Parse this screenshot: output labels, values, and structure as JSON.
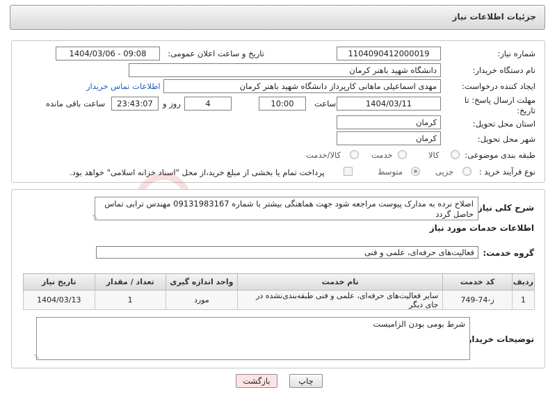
{
  "header": {
    "title": "جزئیات اطلاعات نیاز"
  },
  "form": {
    "need_number": {
      "label": "شماره نیاز:",
      "value": "1104090412000019"
    },
    "announce_datetime": {
      "label": "تاریخ و ساعت اعلان عمومی:",
      "value": "1404/03/06 - 09:08"
    },
    "buyer_org": {
      "label": "نام دستگاه خریدار:",
      "value": "دانشگاه شهید باهنر کرمان"
    },
    "requester": {
      "label": "ایجاد کننده درخواست:",
      "value": "مهدی اسماعیلی ماهانی  کارپرداز دانشگاه شهید باهنر کرمان",
      "link": "اطلاعات تماس خریدار"
    },
    "deadline": {
      "label_line1": "مهلت ارسال پاسخ: تا",
      "label_line2": "تاریخ:",
      "date": "1404/03/11",
      "time_label": "ساعت",
      "time": "10:00",
      "days": "4",
      "days_label": "روز و",
      "remaining": "23:43:07",
      "remaining_label": "ساعت باقی مانده"
    },
    "province": {
      "label": "استان محل تحویل:",
      "value": "کرمان"
    },
    "city": {
      "label": "شهر محل تحویل:",
      "value": "کرمان"
    },
    "category": {
      "label": "طبقه بندی موضوعی:",
      "options": [
        "کالا",
        "خدمت",
        "کالا/خدمت"
      ]
    },
    "purchase_type": {
      "label": "نوع فرآیند خرید :",
      "options": [
        "جزیی",
        "متوسط"
      ],
      "checkbox_text": "پرداخت تمام یا بخشی از مبلغ خرید،از محل \"اسناد خزانه اسلامی\" خواهد بود."
    }
  },
  "details": {
    "general_desc_label": "شرح کلی نیاز:",
    "general_desc": "اصلاح نرده به مدارک پیوست مراجعه شود جهت هماهنگی بیشتر با شماره 09131983167 مهندس ترابی تماس حاصل گردد",
    "services_heading": "اطلاعات خدمات مورد نیاز",
    "service_group_label": "گروه خدمت:",
    "service_group": "فعالیت‌های حرفه‌ای، علمی و فنی",
    "table": {
      "headers": [
        "ردیف",
        "کد خدمت",
        "نام خدمت",
        "واحد اندازه گیری",
        "تعداد / مقدار",
        "تاریخ نیاز"
      ],
      "rows": [
        [
          "1",
          "ز-74-749",
          "سایر فعالیت‌های حرفه‌ای، علمی و فنی طبقه‌بندی‌نشده در جای دیگر",
          "مورد",
          "1",
          "1404/03/13"
        ]
      ]
    },
    "buyer_notes_label": "توضیحات خریدار:",
    "buyer_notes": "شرط بومی بودن الزامیست"
  },
  "buttons": {
    "print": "چاپ",
    "back": "بازگشت"
  },
  "watermark": {
    "text": "AriaTender.neT"
  },
  "colors": {
    "link": "#1b5cc2",
    "back_button": "#fde3e3",
    "header_bg": "#dcdcdc"
  }
}
